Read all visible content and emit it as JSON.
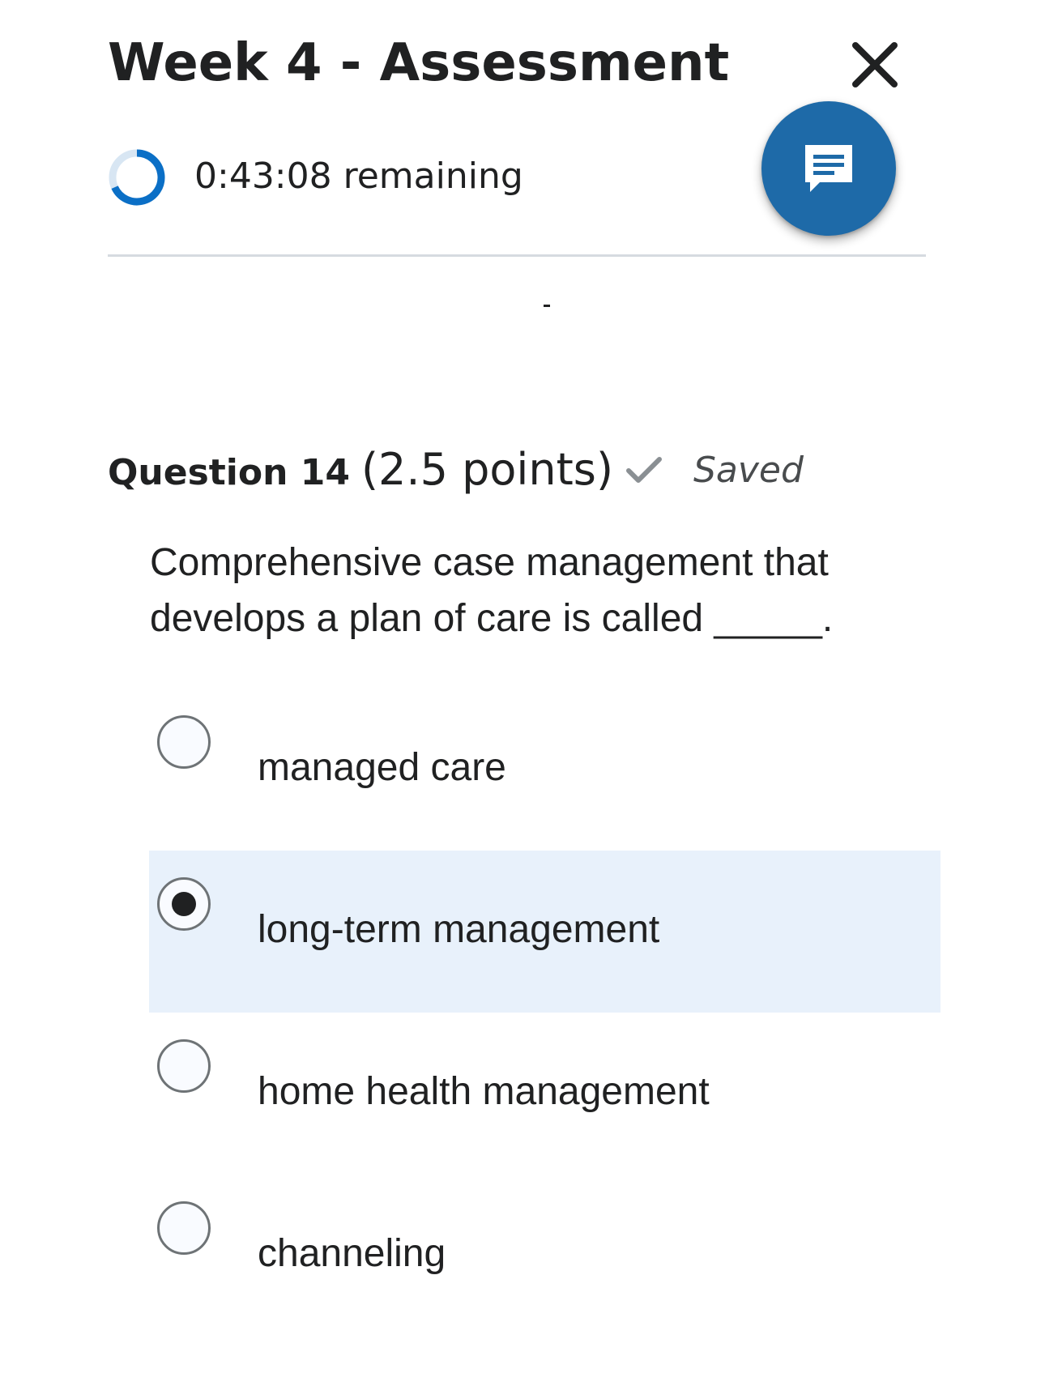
{
  "header": {
    "title": "Week 4 - Assessment",
    "close_icon": "close-icon"
  },
  "timer": {
    "text": "0:43:08 remaining",
    "ring_color": "#0b6fc6",
    "ring_track_color": "#d8e6f3"
  },
  "fab": {
    "icon": "message-icon",
    "color": "#1e6aa8"
  },
  "question": {
    "label": "Question 14",
    "points": "(2.5 points)",
    "status": "Saved",
    "status_icon": "checkmark-icon",
    "prompt": "Comprehensive case management that develops a plan of care is called _____.",
    "options": [
      {
        "label": "managed care",
        "selected": false
      },
      {
        "label": "long-term management",
        "selected": true
      },
      {
        "label": "home health management",
        "selected": false
      },
      {
        "label": "channeling",
        "selected": false
      }
    ]
  },
  "colors": {
    "selected_option_background": "#e8f1fb",
    "text": "#202122"
  }
}
